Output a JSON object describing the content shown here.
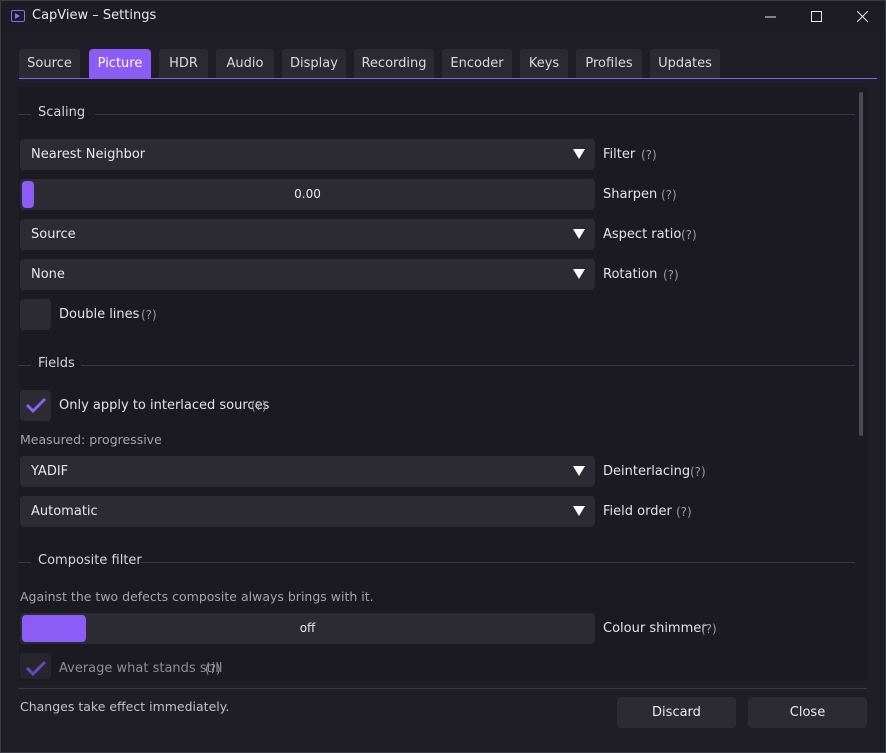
{
  "window": {
    "title": "CapView – Settings"
  },
  "tabs": [
    "Source",
    "Picture",
    "HDR",
    "Audio",
    "Display",
    "Recording",
    "Encoder",
    "Keys",
    "Profiles",
    "Updates"
  ],
  "active_tab": "Picture",
  "help_text": "(?)",
  "scaling": {
    "heading": "Scaling",
    "filter": {
      "value": "Nearest Neighbor",
      "label": "Filter"
    },
    "sharpen": {
      "value": "0.00",
      "label": "Sharpen",
      "level": 0.0
    },
    "aspect_ratio": {
      "value": "Source",
      "label": "Aspect ratio"
    },
    "rotation": {
      "value": "None",
      "label": "Rotation"
    },
    "double_lines": {
      "label": "Double lines",
      "checked": false
    }
  },
  "fields": {
    "heading": "Fields",
    "interlaced_only": {
      "label": "Only apply to interlaced sources",
      "checked": true
    },
    "measured": "Measured: progressive",
    "deinterlacing": {
      "value": "YADIF",
      "label": "Deinterlacing"
    },
    "field_order": {
      "value": "Automatic",
      "label": "Field order"
    }
  },
  "composite": {
    "heading": "Composite filter",
    "description": "Against the two defects composite always brings with it.",
    "colour_shimmer": {
      "value": "off",
      "label": "Colour shimmer"
    },
    "average_still": {
      "label": "Average what stands still",
      "checked": true
    }
  },
  "footer": {
    "status": "Changes take effect immediately.",
    "discard_label": "Discard",
    "close_label": "Close"
  },
  "colors": {
    "accent": "#8b5cf6",
    "background": "#1f1e26",
    "control": "#2c2b34"
  },
  "icons": {
    "app": "capture-app-icon",
    "check": "checkmark-icon"
  }
}
